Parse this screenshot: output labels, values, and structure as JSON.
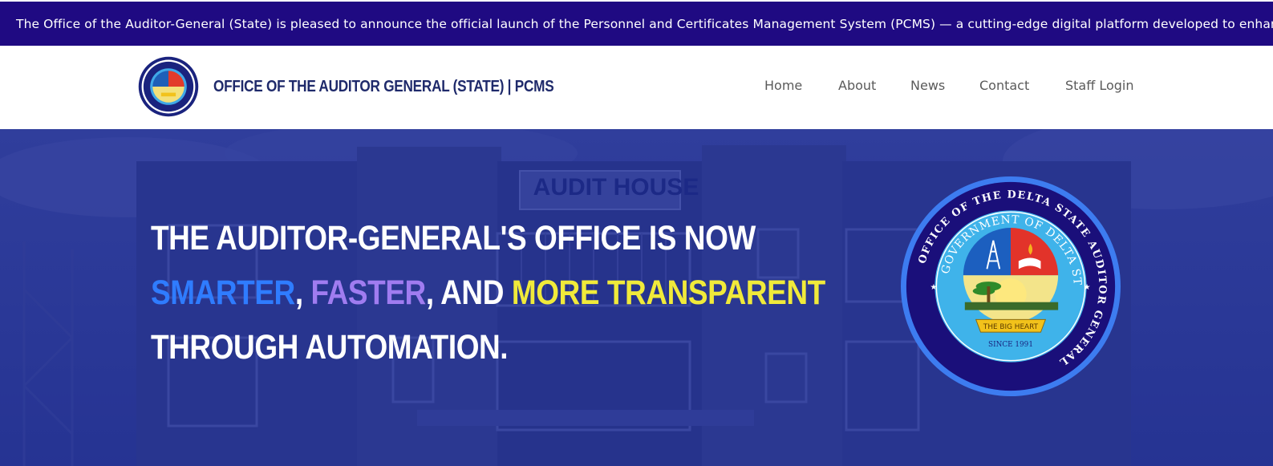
{
  "ticker": {
    "text": "The Office of the Auditor-General (State) is pleased to announce the official launch of the Personnel and Certificates Management System (PCMS) — a cutting-edge digital platform developed to enhance audit operations ac"
  },
  "header": {
    "site_title": "OFFICE OF THE AUDITOR GENERAL (STATE) | PCMS"
  },
  "nav": {
    "items": [
      {
        "label": "Home"
      },
      {
        "label": "About"
      },
      {
        "label": "News"
      },
      {
        "label": "Contact"
      },
      {
        "label": "Staff Login"
      }
    ]
  },
  "hero": {
    "line1": "THE AUDITOR-GENERAL'S OFFICE IS NOW",
    "word_smarter": "SMARTER",
    "sep1": ", ",
    "word_faster": "FASTER",
    "sep2": ", AND ",
    "word_transparent": "MORE TRANSPARENT",
    "line3": "THROUGH AUTOMATION.",
    "building_sign": "AUDIT HOUSE"
  },
  "seal": {
    "outer_text": "OFFICE OF THE DELTA STATE AUDITOR GENERAL",
    "inner_text": "GOVERNMENT OF DELTA STATE NIGERIA",
    "banner": "THE BIG HEART",
    "since": "SINCE 1991"
  },
  "colors": {
    "ticker_bg": "#1f0a82",
    "title": "#1f2a6b",
    "smarter": "#2f7cff",
    "faster": "#a07cf0",
    "transparent": "#f0ea3a"
  }
}
